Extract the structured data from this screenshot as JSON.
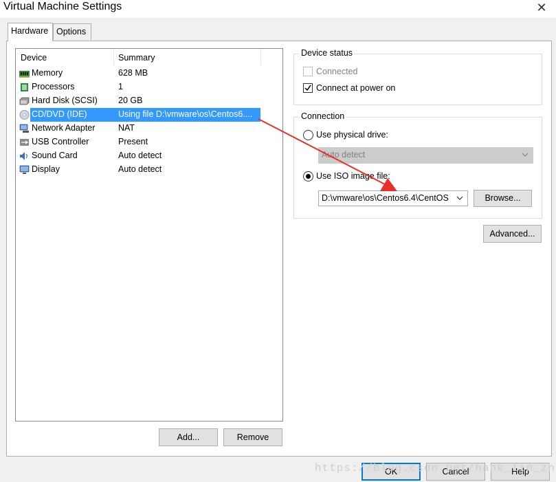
{
  "window": {
    "title": "Virtual Machine Settings",
    "close_glyph": "✕"
  },
  "tabs": [
    {
      "label": "Hardware",
      "active": true
    },
    {
      "label": "Options",
      "active": false
    }
  ],
  "device_list": {
    "headers": {
      "device": "Device",
      "summary": "Summary"
    },
    "rows": [
      {
        "device": "Memory",
        "summary": "628 MB",
        "icon": "memory-icon",
        "selected": false
      },
      {
        "device": "Processors",
        "summary": "1",
        "icon": "processor-icon",
        "selected": false
      },
      {
        "device": "Hard Disk (SCSI)",
        "summary": "20 GB",
        "icon": "hard-disk-icon",
        "selected": false
      },
      {
        "device": "CD/DVD (IDE)",
        "summary": "Using file D:\\vmware\\os\\Centos6....",
        "icon": "cd-dvd-icon",
        "selected": true
      },
      {
        "device": "Network Adapter",
        "summary": "NAT",
        "icon": "network-adapter-icon",
        "selected": false
      },
      {
        "device": "USB Controller",
        "summary": "Present",
        "icon": "usb-icon",
        "selected": false
      },
      {
        "device": "Sound Card",
        "summary": "Auto detect",
        "icon": "sound-card-icon",
        "selected": false
      },
      {
        "device": "Display",
        "summary": "Auto detect",
        "icon": "display-icon",
        "selected": false
      }
    ]
  },
  "list_buttons": {
    "add": "Add...",
    "remove": "Remove"
  },
  "device_status": {
    "title": "Device status",
    "connected": {
      "label": "Connected",
      "checked": false,
      "enabled": false
    },
    "connect_at_power_on": {
      "label": "Connect at power on",
      "checked": true,
      "enabled": true
    }
  },
  "connection": {
    "title": "Connection",
    "physical_drive": {
      "label": "Use physical drive:",
      "selected": false,
      "combo_value": "Auto detect"
    },
    "iso_image": {
      "label": "Use ISO image file:",
      "selected": true,
      "path_value": "D:\\vmware\\os\\Centos6.4\\CentOS",
      "browse_label": "Browse..."
    }
  },
  "advanced_label": "Advanced...",
  "footer": {
    "ok": "OK",
    "cancel": "Cancel",
    "help": "Help"
  },
  "watermark": "https://blog.csdn.net/hank_lin_zhe",
  "colors": {
    "selection": "#3399ff",
    "annotation_arrow": "#e8302a",
    "default_button_border": "#0078d7"
  }
}
